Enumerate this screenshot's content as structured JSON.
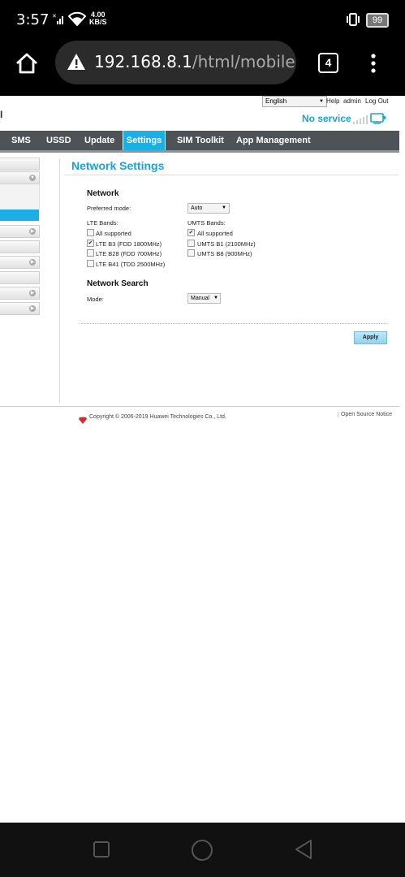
{
  "status_bar": {
    "time": "3:57",
    "speed_value": "4.00",
    "speed_unit": "KB/S",
    "battery": "99"
  },
  "browser": {
    "url_host": "192.168.8.1",
    "url_path": "/html/mobilene",
    "tab_count": "4"
  },
  "header": {
    "language": "English",
    "links": [
      "Help",
      "admin",
      "Log Out"
    ],
    "brand_fragment": "I",
    "connection_status": "No service"
  },
  "nav": {
    "items": [
      "SMS",
      "USSD",
      "Update",
      "Settings",
      "SIM Toolkit",
      "App Management"
    ],
    "active": "Settings"
  },
  "page": {
    "title": "Network Settings",
    "network": {
      "heading": "Network",
      "preferred_mode_label": "Preferred mode:",
      "preferred_mode_value": "Auto",
      "lte_heading": "LTE Bands:",
      "lte_bands": [
        {
          "label": "All supported",
          "checked": false
        },
        {
          "label": "LTE B3 (FDD 1800MHz)",
          "checked": true
        },
        {
          "label": "LTE B28 (FDD 700MHz)",
          "checked": false
        },
        {
          "label": "LTE B41 (TDD 2500MHz)",
          "checked": false
        }
      ],
      "umts_heading": "UMTS Bands:",
      "umts_bands": [
        {
          "label": "All supported",
          "checked": true
        },
        {
          "label": "UMTS B1 (2100MHz)",
          "checked": false
        },
        {
          "label": "UMTS B8 (900MHz)",
          "checked": false
        }
      ]
    },
    "search": {
      "heading": "Network Search",
      "mode_label": "Mode:",
      "mode_value": "Manual"
    },
    "apply_label": "Apply"
  },
  "footer": {
    "copyright": "Copyright © 2006-2019 Huawei Technologies Co., Ltd.",
    "open_source": "Open Source Notice"
  },
  "colors": {
    "accent": "#1ab0e4",
    "nav_bg": "#4e5358",
    "title": "#1aa3d6"
  }
}
